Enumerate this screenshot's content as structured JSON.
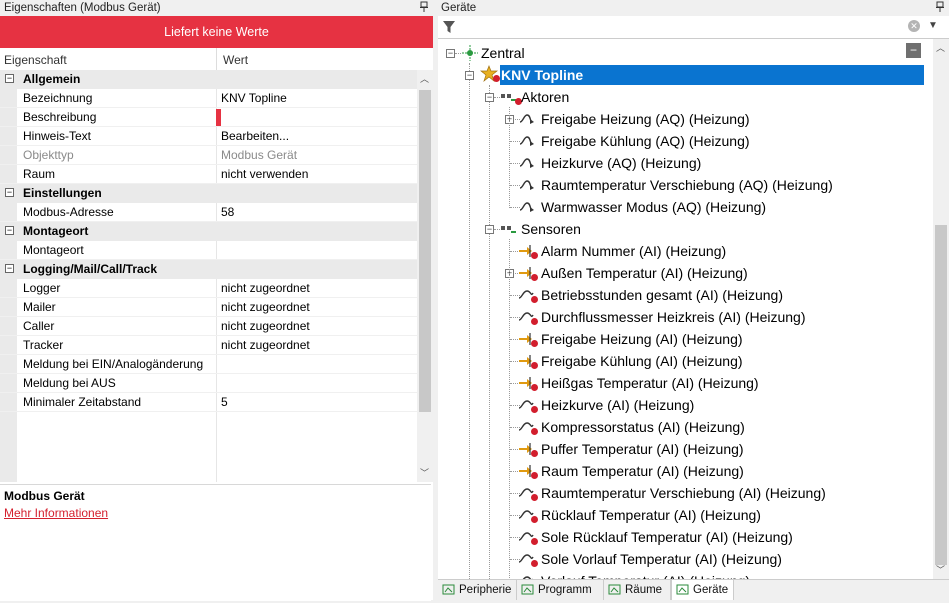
{
  "left_pane": {
    "title": "Eigenschaften (Modbus Gerät)",
    "pin": "📌",
    "alert": "Liefert keine Werte",
    "columns": {
      "name": "Eigenschaft",
      "value": "Wert"
    },
    "rows": [
      {
        "type": "category",
        "name": "Allgemein"
      },
      {
        "type": "prop",
        "name": "Bezeichnung",
        "value": "KNV Topline"
      },
      {
        "type": "prop",
        "name": "Beschreibung",
        "value": ""
      },
      {
        "type": "prop",
        "name": "Hinweis-Text",
        "value": "Bearbeiten..."
      },
      {
        "type": "prop",
        "name": "Objekttyp",
        "value": "Modbus Gerät",
        "disabled": true
      },
      {
        "type": "prop",
        "name": "Raum",
        "value": "nicht verwenden"
      },
      {
        "type": "category",
        "name": "Einstellungen"
      },
      {
        "type": "prop",
        "name": "Modbus-Adresse",
        "value": "58"
      },
      {
        "type": "category",
        "name": "Montageort"
      },
      {
        "type": "prop",
        "name": "Montageort",
        "value": ""
      },
      {
        "type": "category",
        "name": "Logging/Mail/Call/Track"
      },
      {
        "type": "prop",
        "name": "Logger",
        "value": "nicht zugeordnet"
      },
      {
        "type": "prop",
        "name": "Mailer",
        "value": "nicht zugeordnet"
      },
      {
        "type": "prop",
        "name": "Caller",
        "value": "nicht zugeordnet"
      },
      {
        "type": "prop",
        "name": "Tracker",
        "value": "nicht zugeordnet"
      },
      {
        "type": "prop",
        "name": "Meldung bei EIN/Analogänderung",
        "value": ""
      },
      {
        "type": "prop",
        "name": "Meldung bei AUS",
        "value": ""
      },
      {
        "type": "prop",
        "name": "Minimaler Zeitabstand",
        "value": "5"
      }
    ],
    "description": {
      "title": "Modbus Gerät",
      "link": "Mehr Informationen"
    }
  },
  "right_pane": {
    "title": "Geräte",
    "pin": "📌",
    "filter_value": "",
    "root": "Zentral",
    "device": "KNV Topline",
    "groups": [
      {
        "label": "Aktoren",
        "items": [
          {
            "label": "Freigabe Heizung (AQ) (Heizung)",
            "expandable": true
          },
          {
            "label": "Freigabe Kühlung (AQ) (Heizung)"
          },
          {
            "label": "Heizkurve (AQ) (Heizung)"
          },
          {
            "label": "Raumtemperatur Verschiebung (AQ) (Heizung)"
          },
          {
            "label": "Warmwasser Modus (AQ) (Heizung)"
          }
        ]
      },
      {
        "label": "Sensoren",
        "items": [
          {
            "label": "Alarm Nummer (AI) (Heizung)",
            "kind": "arrow"
          },
          {
            "label": "Außen Temperatur (AI) (Heizung)",
            "kind": "arrow",
            "expandable": true
          },
          {
            "label": "Betriebsstunden gesamt (AI) (Heizung)",
            "kind": "wave"
          },
          {
            "label": "Durchflussmesser Heizkreis (AI) (Heizung)",
            "kind": "wave"
          },
          {
            "label": "Freigabe Heizung (AI) (Heizung)",
            "kind": "arrow"
          },
          {
            "label": "Freigabe Kühlung (AI) (Heizung)",
            "kind": "arrow"
          },
          {
            "label": "Heißgas Temperatur (AI) (Heizung)",
            "kind": "arrow"
          },
          {
            "label": "Heizkurve (AI) (Heizung)",
            "kind": "wave"
          },
          {
            "label": "Kompressorstatus (AI) (Heizung)",
            "kind": "wave"
          },
          {
            "label": "Puffer Temperatur (AI) (Heizung)",
            "kind": "arrow"
          },
          {
            "label": "Raum Temperatur (AI) (Heizung)",
            "kind": "arrow"
          },
          {
            "label": "Raumtemperatur Verschiebung (AI) (Heizung)",
            "kind": "wave"
          },
          {
            "label": "Rücklauf Temperatur (AI) (Heizung)",
            "kind": "wave"
          },
          {
            "label": "Sole Rücklauf Temperatur (AI) (Heizung)",
            "kind": "wave"
          },
          {
            "label": "Sole Vorlauf Temperatur (AI) (Heizung)",
            "kind": "wave"
          },
          {
            "label": "Vorlauf Temperatur (AI) (Heizung)",
            "kind": "wave"
          }
        ]
      }
    ],
    "tabs": [
      {
        "label": "Peripherie",
        "active": false
      },
      {
        "label": "Programm",
        "active": false
      },
      {
        "label": "Räume",
        "active": false
      },
      {
        "label": "Geräte",
        "active": true
      }
    ]
  },
  "colors": {
    "alert": "#e63242",
    "selection": "#0a74d0",
    "status_dot": "#d21e2d",
    "link": "#d4202e"
  }
}
